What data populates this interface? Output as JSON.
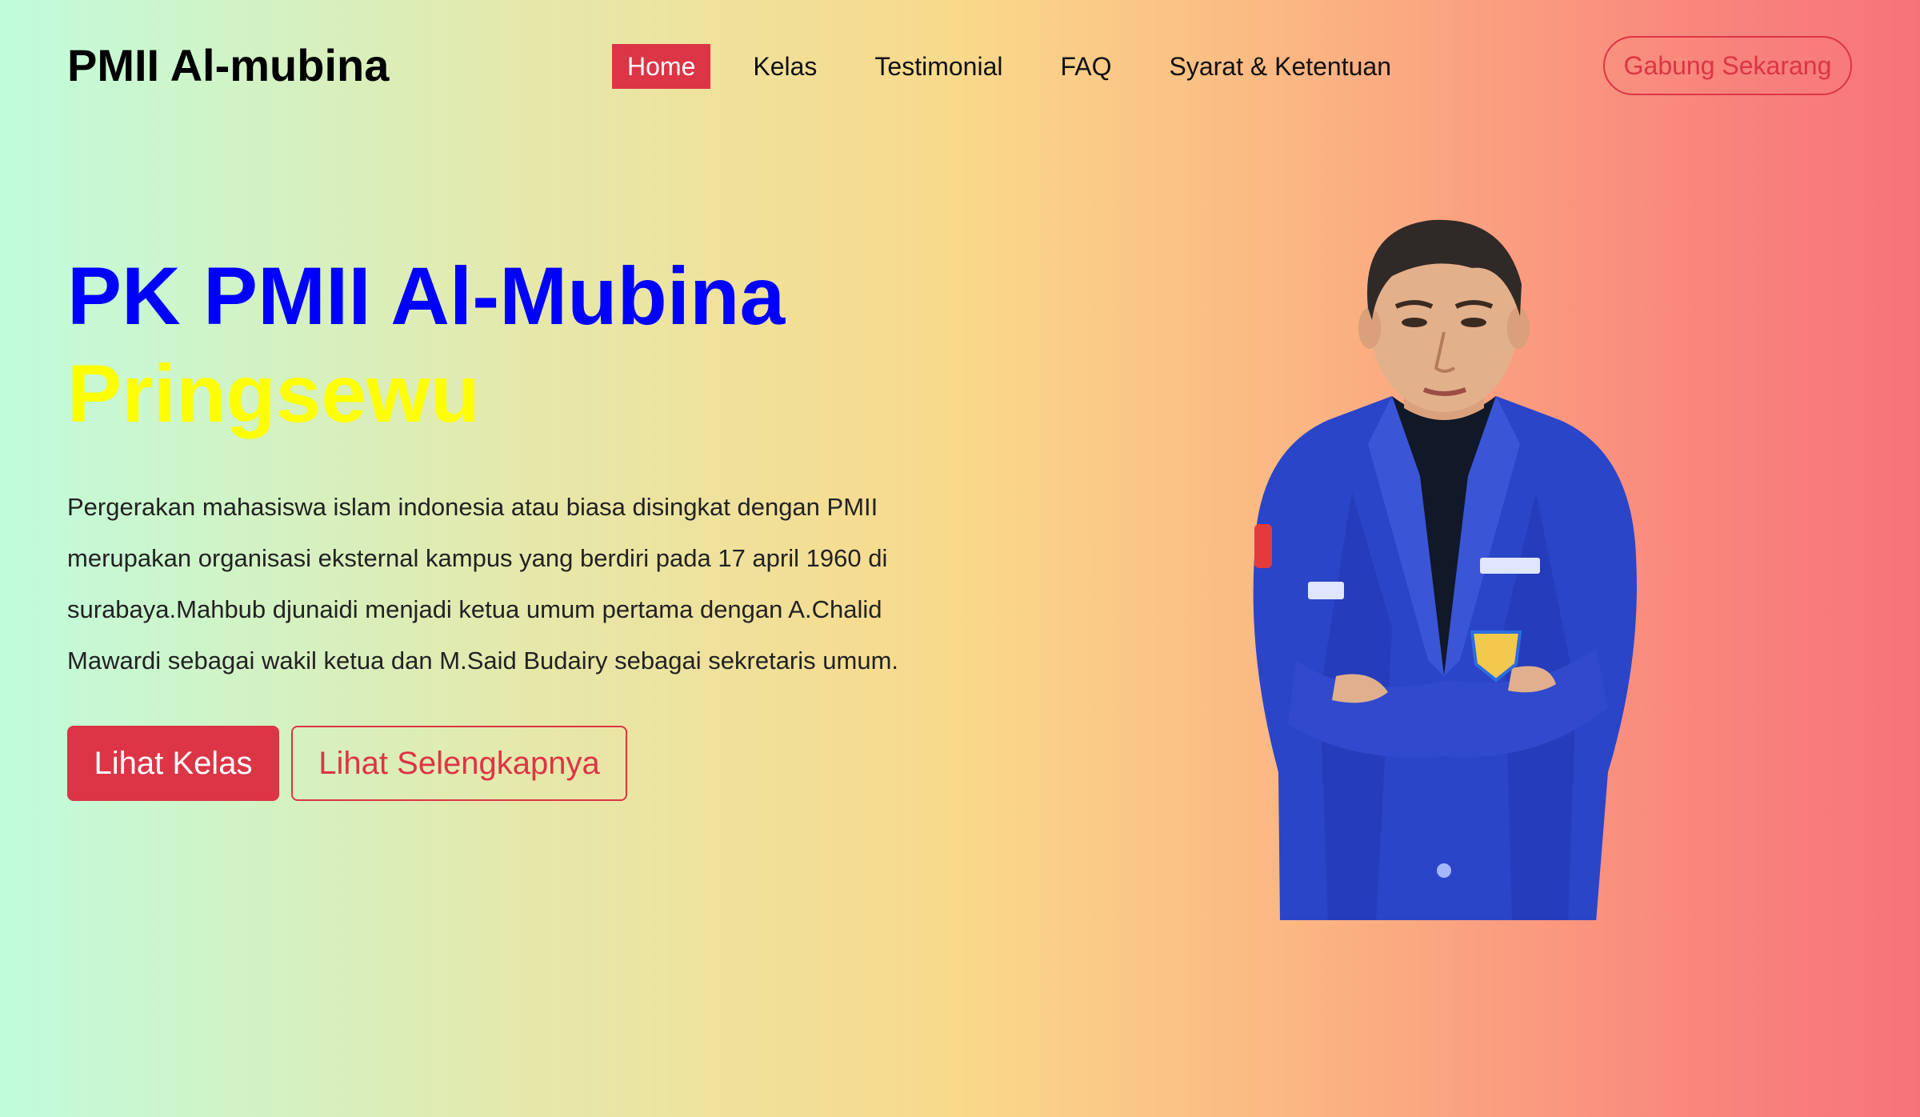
{
  "navbar": {
    "brand": "PMII Al-mubina",
    "links": [
      {
        "label": "Home",
        "active": true
      },
      {
        "label": "Kelas",
        "active": false
      },
      {
        "label": "Testimonial",
        "active": false
      },
      {
        "label": "FAQ",
        "active": false
      },
      {
        "label": "Syarat & Ketentuan",
        "active": false
      }
    ],
    "cta_label": "Gabung Sekarang"
  },
  "hero": {
    "title_line1": "PK PMII Al-Mubina",
    "title_line2": "Pringsewu",
    "description": "Pergerakan mahasiswa islam indonesia atau biasa disingkat dengan PMII merupakan organisasi eksternal kampus yang berdiri pada 17 april 1960 di surabaya.Mahbub djunaidi menjadi ketua umum pertama dengan A.Chalid Mawardi sebagai wakil ketua dan M.Said Budairy sebagai sekretaris umum.",
    "primary_button": "Lihat Kelas",
    "secondary_button": "Lihat Selengkapnya",
    "image": "portrait-photo"
  },
  "colors": {
    "accent": "#dc3545",
    "title_blue": "#0000ff",
    "title_yellow": "#ffff00",
    "gradient_start": "#c0fcdc",
    "gradient_end": "#f7737a"
  }
}
